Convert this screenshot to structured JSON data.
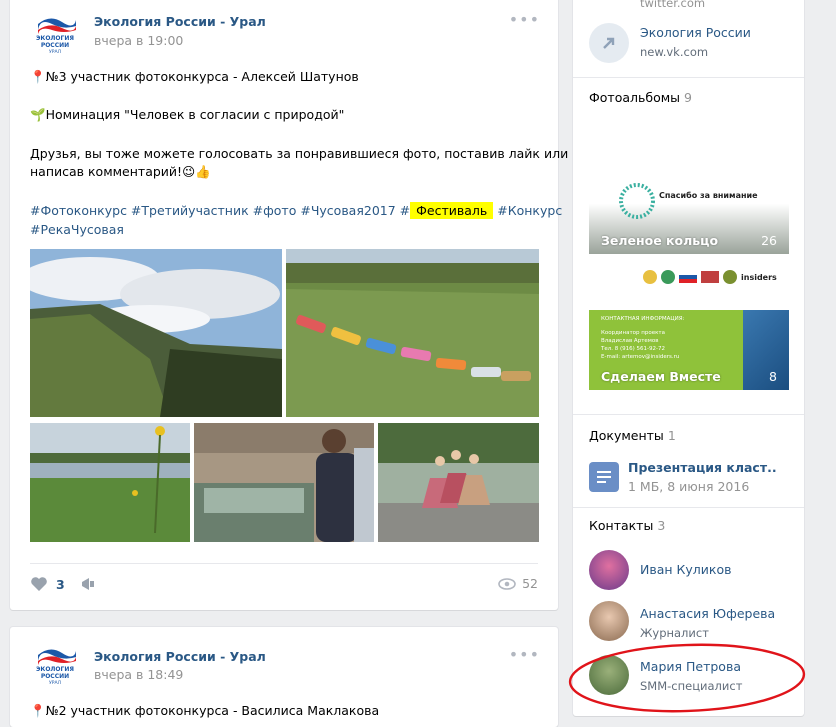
{
  "colors": {
    "link": "#2a5885",
    "muted": "#939393",
    "bg": "#edeef0",
    "highlight": "#ffff00",
    "annotation": "#e0141a"
  },
  "logo_text": [
    "ЭКОЛОГИЯ",
    "РОССИИ",
    "УРАЛ"
  ],
  "post1": {
    "author": "Экология России - Урал",
    "time": "вчера в 19:00",
    "line1": "№3 участник фотоконкурса - Алексей Шатунов",
    "line1_icon": "pin-icon",
    "line2": "Номинация \"Человек в согласии с природой\"",
    "line2_icon": "sprout-icon",
    "line3": "Друзья, вы тоже можете голосовать за понравившиеся фото, поставив лайк или",
    "line4": "написав комментарий!",
    "tags_row1": [
      "#Фотоконкурс",
      "#Третийучастник",
      "#фото",
      "#Чусовая2017",
      "#"
    ],
    "tag_highlight": "Фестиваль",
    "tag_after": "#Конкурс",
    "tags_row2": [
      "#РекаЧусовая"
    ],
    "likes": "3",
    "views": "52"
  },
  "post2": {
    "author": "Экология России - Урал",
    "time": "вчера в 18:49",
    "line1": "№2 участник фотоконкурса - Василиса Маклакова"
  },
  "sidebar": {
    "link_top": "twitter.com",
    "link_title": "Экология России",
    "link_url": "new.vk.com",
    "albums_title": "Фотоальбомы",
    "albums_count": "9",
    "albums": [
      {
        "name": "Зеленое кольцо",
        "count": "26",
        "caption": "Спасибо за внимание"
      },
      {
        "name": "Сделаем Вместе",
        "count": "8",
        "caption": "КОНТАКТНАЯ ИНФОРМАЦИЯ:",
        "lines": [
          "Координатор проекта",
          "Владислав Артемов",
          "Тел. 8 (916) 561-92-72",
          "E-mail: artemov@insiders.ru"
        ]
      }
    ],
    "album_strip_text": "insiders",
    "docs_title": "Документы",
    "docs_count": "1",
    "doc_name": "Презентация класт..",
    "doc_meta": "1 МБ, 8 июня 2016",
    "contacts_title": "Контакты",
    "contacts_count": "3",
    "contacts": [
      {
        "name": "Иван Куликов",
        "role": ""
      },
      {
        "name": "Анастасия Юферева",
        "role": "Журналист"
      },
      {
        "name": "Мария Петрова",
        "role": "SMM-специалист"
      }
    ]
  }
}
